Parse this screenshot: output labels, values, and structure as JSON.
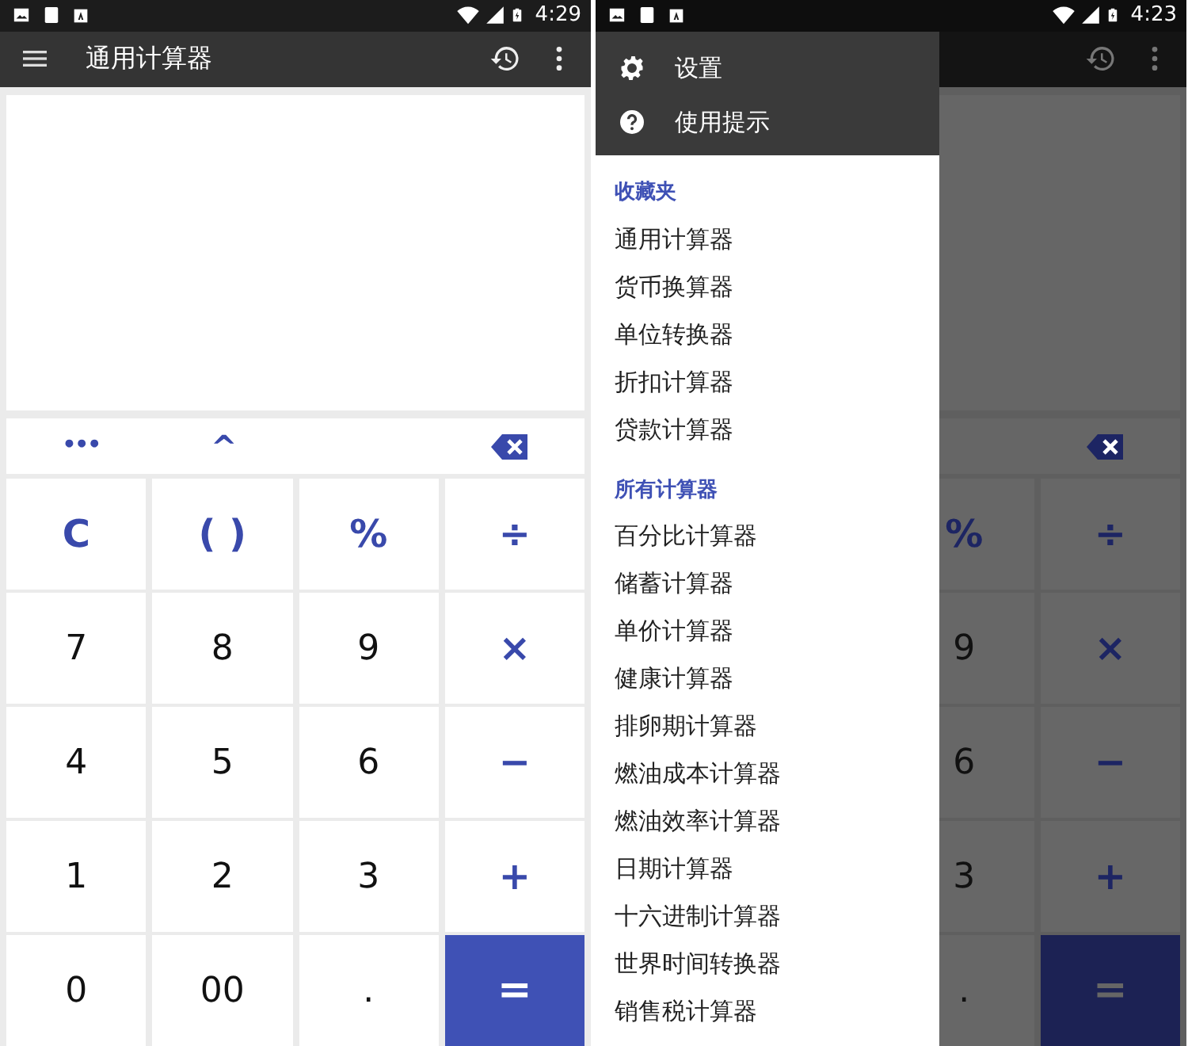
{
  "screens": [
    {
      "status_bar": {
        "time": "4:29"
      },
      "toolbar": {
        "title": "通用计算器"
      },
      "dimmed": false,
      "function_row": [
        {
          "kind": "text",
          "label": "•••"
        },
        {
          "kind": "text",
          "label": "^"
        },
        {
          "kind": "empty"
        },
        {
          "kind": "backspace"
        }
      ],
      "keys": [
        [
          {
            "kind": "operator",
            "label": "C"
          },
          {
            "kind": "operator",
            "label": "( )"
          },
          {
            "kind": "operator",
            "label": "%"
          },
          {
            "kind": "operator",
            "label": "÷"
          }
        ],
        [
          {
            "kind": "number",
            "label": "7"
          },
          {
            "kind": "number",
            "label": "8"
          },
          {
            "kind": "number",
            "label": "9"
          },
          {
            "kind": "operator",
            "label": "×"
          }
        ],
        [
          {
            "kind": "number",
            "label": "4"
          },
          {
            "kind": "number",
            "label": "5"
          },
          {
            "kind": "number",
            "label": "6"
          },
          {
            "kind": "operator",
            "label": "−"
          }
        ],
        [
          {
            "kind": "number",
            "label": "1"
          },
          {
            "kind": "number",
            "label": "2"
          },
          {
            "kind": "number",
            "label": "3"
          },
          {
            "kind": "operator",
            "label": "+"
          }
        ],
        [
          {
            "kind": "number",
            "label": "0"
          },
          {
            "kind": "number",
            "label": "00"
          },
          {
            "kind": "number",
            "label": "."
          },
          {
            "kind": "equals",
            "label": "="
          }
        ]
      ]
    },
    {
      "status_bar": {
        "time": "4:23"
      },
      "dimmed": true,
      "function_row": [
        {
          "kind": "empty"
        },
        {
          "kind": "empty"
        },
        {
          "kind": "empty"
        },
        {
          "kind": "backspace"
        }
      ],
      "keys": [
        [
          {
            "kind": "blank"
          },
          {
            "kind": "blank"
          },
          {
            "kind": "operator",
            "label": "%"
          },
          {
            "kind": "operator",
            "label": "÷"
          }
        ],
        [
          {
            "kind": "blank"
          },
          {
            "kind": "blank"
          },
          {
            "kind": "number",
            "label": "9"
          },
          {
            "kind": "operator",
            "label": "×"
          }
        ],
        [
          {
            "kind": "blank"
          },
          {
            "kind": "blank"
          },
          {
            "kind": "number",
            "label": "6"
          },
          {
            "kind": "operator",
            "label": "−"
          }
        ],
        [
          {
            "kind": "blank"
          },
          {
            "kind": "blank"
          },
          {
            "kind": "number",
            "label": "3"
          },
          {
            "kind": "operator",
            "label": "+"
          }
        ],
        [
          {
            "kind": "blank"
          },
          {
            "kind": "blank"
          },
          {
            "kind": "number",
            "label": "."
          },
          {
            "kind": "equals",
            "label": "="
          }
        ]
      ],
      "drawer": {
        "menu": [
          {
            "kind": "settings",
            "label": "设置"
          },
          {
            "kind": "help",
            "label": "使用提示"
          }
        ],
        "sections": [
          {
            "title": "收藏夹",
            "items": [
              "通用计算器",
              "货币换算器",
              "单位转换器",
              "折扣计算器",
              "贷款计算器"
            ]
          },
          {
            "title": "所有计算器",
            "items": [
              "百分比计算器",
              "储蓄计算器",
              "单价计算器",
              "健康计算器",
              "排卵期计算器",
              "燃油成本计算器",
              "燃油效率计算器",
              "日期计算器",
              "十六进制计算器",
              "世界时间转换器",
              "销售税计算器"
            ]
          }
        ]
      }
    }
  ]
}
